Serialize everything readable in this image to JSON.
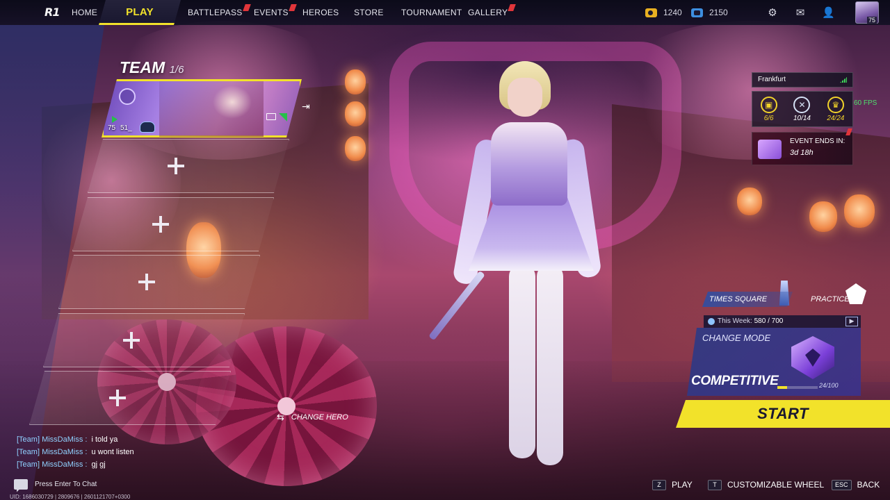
{
  "nav": {
    "home": "HOME",
    "play": "PLAY",
    "battlepass": "BATTLEPASS",
    "events": "EVENTS",
    "heroes": "HEROES",
    "store": "STORE",
    "tournament": "TOURNAMENT",
    "gallery": "GALLERY",
    "brand_logo": "R1"
  },
  "currency": {
    "gold": "1240",
    "gems": "2150"
  },
  "profile": {
    "level": "75"
  },
  "team": {
    "title": "TEAM",
    "count": "1/6",
    "member": {
      "level": "75",
      "name": "51_"
    },
    "change_hero": "CHANGE HERO"
  },
  "chat": {
    "messages": [
      {
        "sender": "[Team] MissDaMiss :",
        "text": "i told ya"
      },
      {
        "sender": "[Team] MissDaMiss :",
        "text": "u wont listen"
      },
      {
        "sender": "[Team] MissDaMiss :",
        "text": "gj gj"
      }
    ],
    "input_hint": "Press Enter To Chat",
    "uid": "UID: 1686030729 | 2809676 | 2601121707+0300"
  },
  "server": {
    "region": "Frankfurt",
    "fps": "60 FPS"
  },
  "stats": {
    "first": "6/6",
    "second": "10/14",
    "third": "24/24"
  },
  "event": {
    "label": "EVENT ENDS IN:",
    "time": "3d 18h"
  },
  "mode": {
    "map_tab": "TIMES SQUARE",
    "practice_tab": "PRACTICE",
    "this_week_label": "This Week:",
    "this_week_value": "580 / 700",
    "change_mode": "CHANGE MODE",
    "name": "COMPETITIVE",
    "rank_points": "24/100",
    "rank_progress": 0.24,
    "start": "START"
  },
  "hints": {
    "play_key": "Z",
    "play": "PLAY",
    "wheel_key": "T",
    "wheel": "CUSTOMIZABLE WHEEL",
    "back_key": "ESC",
    "back": "BACK"
  },
  "colors": {
    "accent": "#f2e22a",
    "nav_bg": "#14142a",
    "mode_panel": "#303a82",
    "chat_sender": "#8fd1ff",
    "fps": "#4ee06b",
    "notification_flag": "#e0353a"
  }
}
